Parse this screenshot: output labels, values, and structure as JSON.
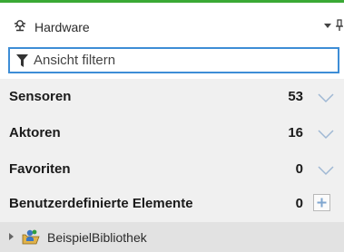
{
  "panel": {
    "title": "Hardware",
    "accent_color": "#3aa935",
    "filter_border_color": "#3d8dd6"
  },
  "filter": {
    "placeholder": "Ansicht filtern",
    "value": ""
  },
  "categories": [
    {
      "label": "Sensoren",
      "count": "53",
      "action": "chevron-down-icon"
    },
    {
      "label": "Aktoren",
      "count": "16",
      "action": "chevron-down-icon"
    },
    {
      "label": "Favoriten",
      "count": "0",
      "action": "chevron-down-icon"
    },
    {
      "label": "Benutzerdefinierte Elemente",
      "count": "0",
      "action": "plus-icon"
    }
  ],
  "library": {
    "label": "BeispielBibliothek",
    "expanded": false
  }
}
